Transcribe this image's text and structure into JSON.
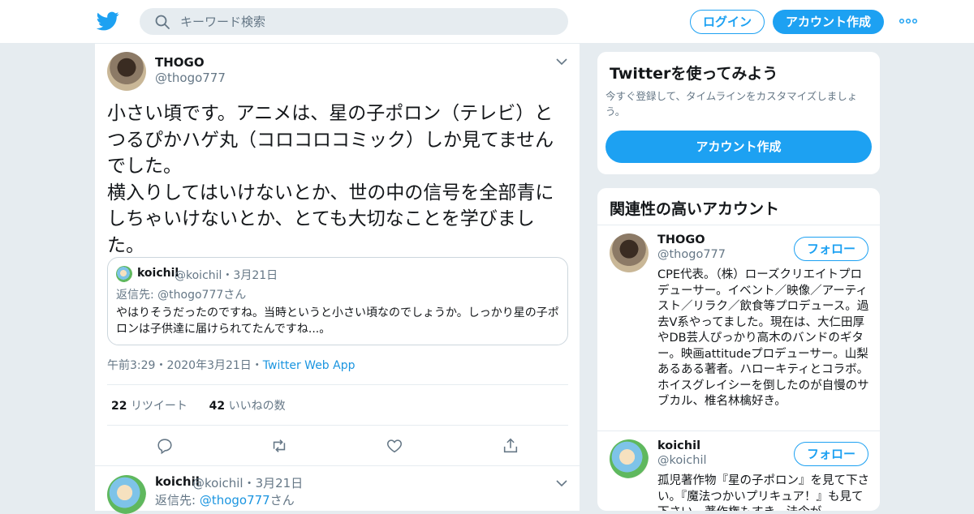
{
  "header": {
    "search_placeholder": "キーワード検索",
    "login_label": "ログイン",
    "signup_label": "アカウント作成"
  },
  "tweet": {
    "name": "THOGO",
    "handle": "@thogo777",
    "text": "小さい頃です。アニメは、星の子ポロン（テレビ）とつるぴかハゲ丸（コロコロコミック）しか見てませんでした。\n横入りしてはいけないとか、世の中の信号を全部青にしちゃいけないとか、とても大切なことを学びました。",
    "quote": {
      "name": "koichil",
      "handle_date": "@koichil・3月21日",
      "reply_to": "返信先: @thogo777さん",
      "text": "やはりそうだったのですね。当時というと小さい頃なのでしょうか。しっかり星の子ポロンは子供達に届けられてたんですね...。"
    },
    "time": "午前3:29・2020年3月21日・",
    "source": "Twitter Web App",
    "retweets_count": "22",
    "retweets_label": "リツイート",
    "likes_count": "42",
    "likes_label": "いいねの数"
  },
  "reply": {
    "name": "koichil",
    "handle_date": "@koichil・3月21日",
    "reply_to_prefix": "返信先: ",
    "reply_to_handle": "@thogo777",
    "reply_to_suffix": "さん"
  },
  "signup_card": {
    "title": "Twitterを使ってみよう",
    "subtitle": "今すぐ登録して、タイムラインをカスタマイズしましょう。",
    "button": "アカウント作成"
  },
  "related": {
    "title": "関連性の高いアカウント",
    "accounts": [
      {
        "name": "THOGO",
        "handle": "@thogo777",
        "follow": "フォロー",
        "bio": "CPE代表。（株）ローズクリエイトプロデューサー。イベント／映像／アーティスト／リラク／飲食等プロデュース。過去V系やってました。現在は、大仁田厚やDB芸人ぴっかり高木のバンドのギター。映画attitudeプロデューサー。山梨あるある著者。ハローキティとコラボ。ホイスグレイシーを倒したのが自慢のサブカル、椎名林檎好き。"
      },
      {
        "name": "koichil",
        "handle": "@koichil",
        "follow": "フォロー",
        "bio": "孤児著作物『星の子ポロン』を見て下さい。『魔法つかいプリキュア！』も見て下さい。著作権もすき。法令が"
      }
    ]
  },
  "colors": {
    "accent": "#1da1f2",
    "muted": "#657786",
    "border": "#e6ecf0"
  }
}
